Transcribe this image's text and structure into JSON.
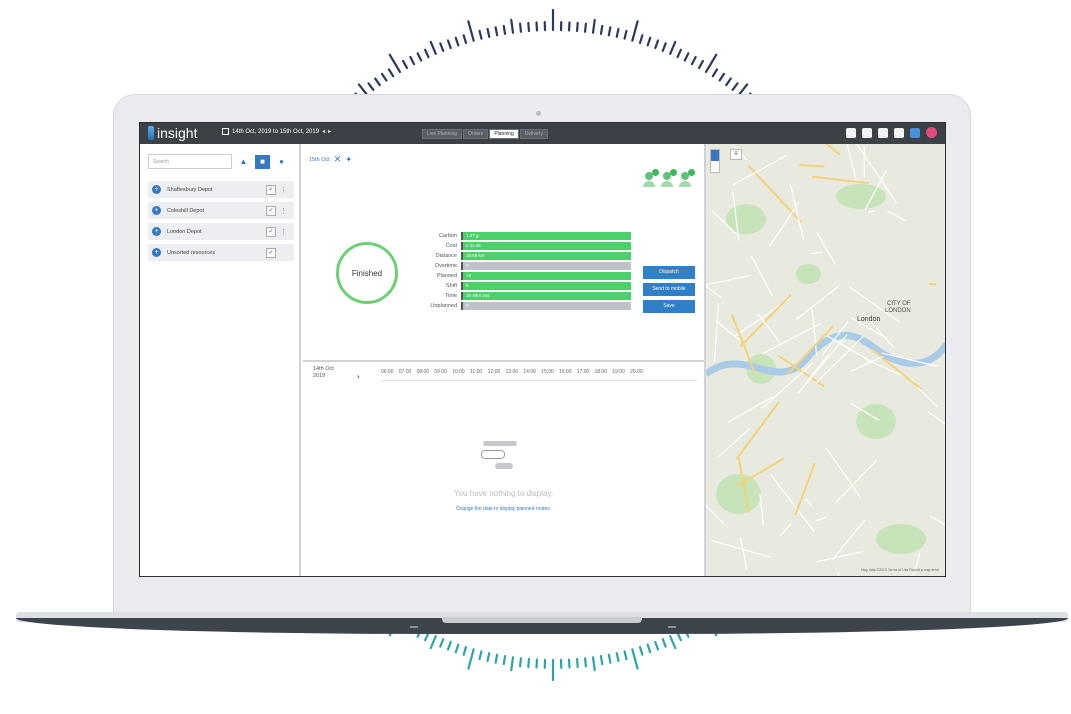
{
  "app": {
    "brand": "insight",
    "date_range": "14th Oct, 2019 to 15th Oct, 2019"
  },
  "modes": [
    {
      "label": "Live Planning",
      "active": false
    },
    {
      "label": "Orders",
      "active": false
    },
    {
      "label": "Planning",
      "active": true
    },
    {
      "label": "Delivery",
      "active": false
    }
  ],
  "sidebar": {
    "search_placeholder": "Search",
    "depots": [
      {
        "label": "Shaftesbury Depot"
      },
      {
        "label": "Coleshill Depot"
      },
      {
        "label": "London Depot"
      },
      {
        "label": "Unsorted resources"
      }
    ]
  },
  "summary": {
    "date_label": "15th Oct",
    "status": "Finished",
    "metrics": [
      {
        "label": "Carbon",
        "value": "1.37 g",
        "fill": 1.0,
        "grey": false
      },
      {
        "label": "Cost",
        "value": "£ 11.49",
        "fill": 1.0,
        "grey": false
      },
      {
        "label": "Distance",
        "value": "10.69 km",
        "fill": 1.0,
        "grey": false
      },
      {
        "label": "Overtime",
        "value": "0",
        "fill": 1.0,
        "grey": true
      },
      {
        "label": "Planned",
        "value": "12",
        "fill": 1.0,
        "grey": false
      },
      {
        "label": "Shift",
        "value": "8",
        "fill": 1.0,
        "grey": false
      },
      {
        "label": "Time",
        "value": "1h 49m 24s",
        "fill": 1.0,
        "grey": false
      },
      {
        "label": "Unplanned",
        "value": "0",
        "fill": 1.0,
        "grey": true
      }
    ],
    "actions": {
      "dispatch": "Dispatch",
      "send_mobile": "Send to mobile",
      "save": "Save"
    }
  },
  "timeline": {
    "date_line1": "14th Oct",
    "date_line2": "2019",
    "hours": [
      "06:00",
      "07:00",
      "08:00",
      "09:00",
      "10:00",
      "11:00",
      "12:00",
      "13:00",
      "14:00",
      "15:00",
      "16:00",
      "17:00",
      "18:00",
      "19:00",
      "20:00"
    ],
    "empty_message": "You have nothing to display.",
    "empty_link": "Change the date to display planned routes."
  },
  "map": {
    "labels": [
      "CITY OF",
      "LONDON",
      "London"
    ],
    "footer": "Map data ©2019   Terms of Use   Report a map error"
  },
  "colors": {
    "topbar": "#3c4047",
    "accent": "#2f7fc9",
    "bar_green": "#49d26a",
    "bar_grey": "#bfc2c6",
    "finished_ring": "#6dcf76"
  }
}
